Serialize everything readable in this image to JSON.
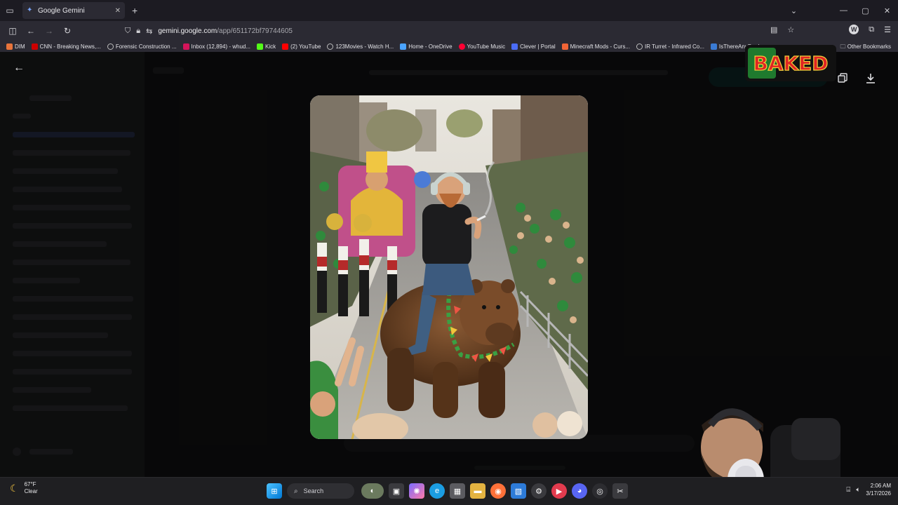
{
  "browser": {
    "tab_title": "Google Gemini",
    "url_host": "gemini.google.com",
    "url_path": "/app/651172bf79744605",
    "bookmarks": [
      {
        "label": "DIM",
        "color": "#e8743b"
      },
      {
        "label": "CNN - Breaking News,...",
        "color": "#cc0000"
      },
      {
        "label": "Forensic Construction ...",
        "color": "#9aa0a6"
      },
      {
        "label": "Inbox (12,894) - whud...",
        "color": "#d4145a"
      },
      {
        "label": "Kick",
        "color": "#53fc18"
      },
      {
        "label": "(2) YouTube",
        "color": "#ff0000"
      },
      {
        "label": "123Movies - Watch H...",
        "color": "#9aa0a6"
      },
      {
        "label": "Home - OneDrive",
        "color": "#4aa3ff"
      },
      {
        "label": "YouTube Music",
        "color": "#ff0033"
      },
      {
        "label": "Clever | Portal",
        "color": "#4a6cf7"
      },
      {
        "label": "Minecraft Mods - Curs...",
        "color": "#f16436"
      },
      {
        "label": "IR Turret - Infrared Co...",
        "color": "#9aa0a6"
      },
      {
        "label": "IsThereAnyDeal",
        "color": "#3a7bd5"
      }
    ],
    "other_bookmarks": "Other Bookmarks"
  },
  "overlay_logo": {
    "text": "BAKED"
  },
  "taskbar": {
    "weather_temp": "67°F",
    "weather_desc": "Clear",
    "search_label": "Search",
    "time": "2:06 AM",
    "date": "3/17/2026"
  },
  "icons": {
    "sidebar_toggle": "sidebar-icon",
    "back": "back-arrow-icon",
    "copy": "copy-icon",
    "download": "download-icon"
  }
}
